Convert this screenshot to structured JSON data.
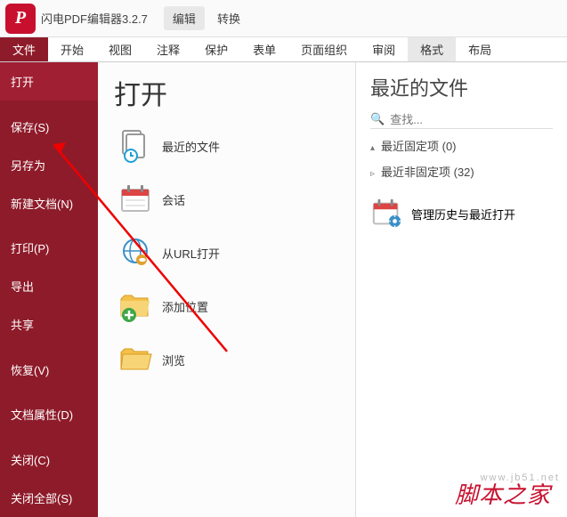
{
  "titlebar": {
    "logo": "P",
    "title": "闪电PDF编辑器3.2.7",
    "tabs": [
      "编辑",
      "转换"
    ]
  },
  "ribbon": [
    "文件",
    "开始",
    "视图",
    "注释",
    "保护",
    "表单",
    "页面组织",
    "审阅",
    "格式",
    "布局"
  ],
  "sidebar": {
    "open": "打开",
    "save": "保存(S)",
    "saveas": "另存为",
    "new": "新建文档(N)",
    "print": "打印(P)",
    "export": "导出",
    "share": "共享",
    "recover": "恢复(V)",
    "docprops": "文档属性(D)",
    "close": "关闭(C)",
    "closeall": "关闭全部(S)"
  },
  "center": {
    "heading": "打开",
    "recent": "最近的文件",
    "session": "会话",
    "fromurl": "从URL打开",
    "addloc": "添加位置",
    "browse": "浏览"
  },
  "right": {
    "heading": "最近的文件",
    "searchPlaceholder": "查找...",
    "pinned": "最近固定项 (0)",
    "unpinned": "最近非固定项 (32)",
    "history": "管理历史与最近打开"
  },
  "watermark": "脚本之家",
  "watermark_url": "www.jb51.net"
}
